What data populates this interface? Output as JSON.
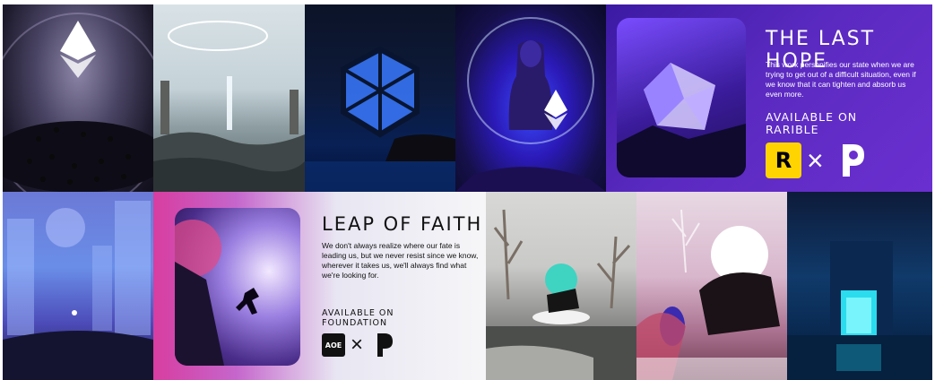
{
  "panels": {
    "last_hope": {
      "title": "THE LAST HOPE",
      "description": "This work personifies our state when we are trying to get out of a difficult situation, even if we know that it can tighten and absorb us even more.",
      "available": "AVAILABLE ON",
      "platform": "RARIBLE",
      "logo_letter": "R",
      "times": "×"
    },
    "leap_of_faith": {
      "title": "LEAP OF FAITH",
      "description": "We don't always realize where our fate is leading us, but we never resist since we know, wherever it takes us, we'll always find what we're looking for.",
      "available": "AVAILABLE ON",
      "platform": "FOUNDATION",
      "logo_text": "AOE",
      "times": "×"
    }
  }
}
